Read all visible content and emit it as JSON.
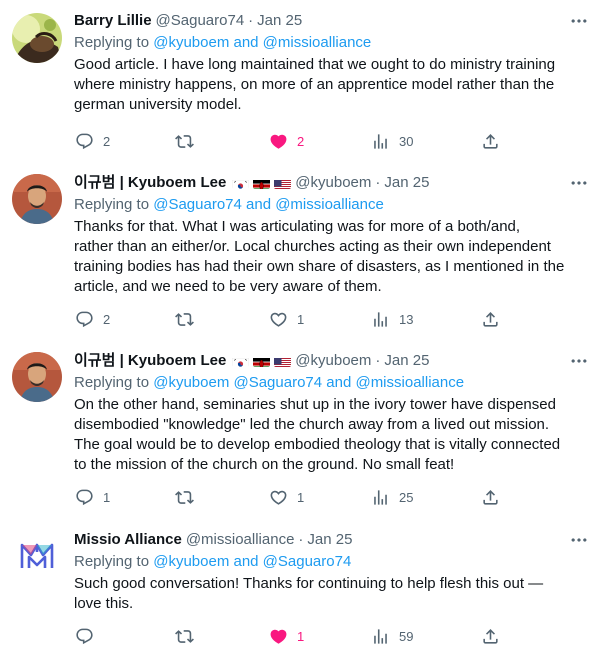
{
  "tweets": [
    {
      "name": "Barry Lillie",
      "handle": "@Saguaro74",
      "dot": "·",
      "date": "Jan 25",
      "replying_prefix": "Replying to ",
      "replying_mentions": "@kyuboem and @missioalliance",
      "text": "Good article.  I have long maintained that we ought to do ministry training\nwhere ministry happens, on more of an apprentice model rather than the\ngerman university model.",
      "replies": "2",
      "retweets": "",
      "likes": "2",
      "liked": true,
      "views": "30"
    },
    {
      "name": "이규범 | Kyuboem Lee",
      "flags": [
        "kr",
        "ke",
        "us"
      ],
      "handle": "@kyuboem",
      "dot": "·",
      "date": "Jan 25",
      "replying_prefix": "Replying to ",
      "replying_mentions": "@Saguaro74 and @missioalliance",
      "text": "Thanks for that. What I was articulating was for more of a both/and,\nrather than an either/or. Local churches acting as their own independent\ntraining bodies has had their own share of disasters, as I mentioned in the\narticle, and we need to be very aware of them.",
      "replies": "2",
      "retweets": "",
      "likes": "1",
      "liked": false,
      "views": "13"
    },
    {
      "name": "이규범 | Kyuboem Lee",
      "flags": [
        "kr",
        "ke",
        "us"
      ],
      "handle": "@kyuboem",
      "dot": "·",
      "date": "Jan 25",
      "replying_prefix": "Replying to ",
      "replying_mentions": "@kyuboem @Saguaro74 and @missioalliance",
      "text": "On the other hand, seminaries shut up in the ivory tower have dispensed\ndisembodied \"knowledge\" led the church away from a lived out mission.\nThe goal would be to develop embodied theology that is vitally connected\nto the mission of the church on the ground. No small feat!",
      "replies": "1",
      "retweets": "",
      "likes": "1",
      "liked": false,
      "views": "25"
    },
    {
      "name": "Missio Alliance",
      "handle": "@missioalliance",
      "dot": "·",
      "date": "Jan 25",
      "replying_prefix": "Replying to ",
      "replying_mentions": "@kyuboem and @Saguaro74",
      "text": "Such good conversation! Thanks for continuing to help flesh this out —\nlove this.",
      "replies": "",
      "retweets": "",
      "likes": "1",
      "liked": true,
      "views": "59"
    }
  ],
  "colors": {
    "link": "#1d9bf0",
    "muted": "#536471",
    "like": "#f91880",
    "text": "#0f1419",
    "missio_logo": "#4f5fd8"
  },
  "icons": [
    "reply-icon",
    "retweet-icon",
    "like-icon",
    "views-icon",
    "share-icon",
    "more-icon"
  ]
}
